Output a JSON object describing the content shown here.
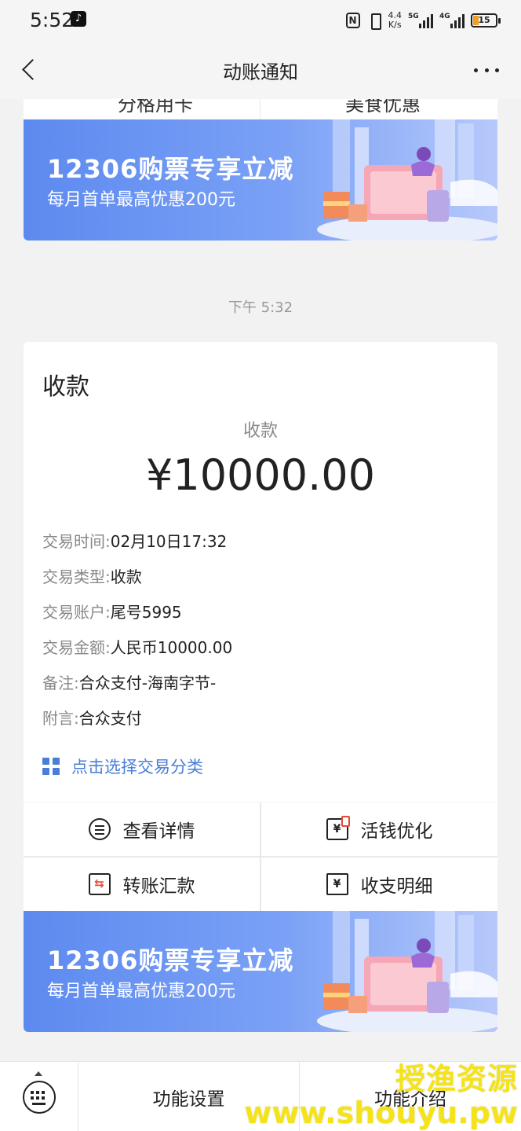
{
  "status_bar": {
    "time": "5:52",
    "net_speed_value": "4.4",
    "net_speed_unit": "K/s",
    "signal1_tag": "5G",
    "signal2_tag": "4G",
    "battery": "15"
  },
  "nav": {
    "title": "动账通知"
  },
  "top_card": {
    "left_label": "分格用卡",
    "right_label": "美食优惠"
  },
  "banner": {
    "title": "12306购票专享立减",
    "subtitle": "每月首单最高优惠200元"
  },
  "timestamp": "下午 5:32",
  "card": {
    "title": "收款",
    "amount_label": "收款",
    "amount": "¥10000.00",
    "details": [
      {
        "key": "交易时间:",
        "value": "02月10日17:32"
      },
      {
        "key": "交易类型:",
        "value": "收款"
      },
      {
        "key": "交易账户:",
        "value": "尾号5995"
      },
      {
        "key": "交易金额:",
        "value": "人民币10000.00"
      },
      {
        "key": "备注:",
        "value": "合众支付-海南字节-"
      },
      {
        "key": "附言:",
        "value": "合众支付"
      }
    ],
    "category_link": "点击选择交易分类"
  },
  "actions": {
    "view_details": "查看详情",
    "optimize": "活钱优化",
    "transfer": "转账汇款",
    "statement": "收支明细"
  },
  "bottom_bar": {
    "settings": "功能设置",
    "intro": "功能介绍"
  },
  "watermark": {
    "text": "授渔资源",
    "url": "www.shouyu.pw"
  },
  "colors": {
    "banner_blue": "#5d8af0",
    "link_blue": "#4a7ed6",
    "watermark_yellow": "#f5e31a"
  }
}
